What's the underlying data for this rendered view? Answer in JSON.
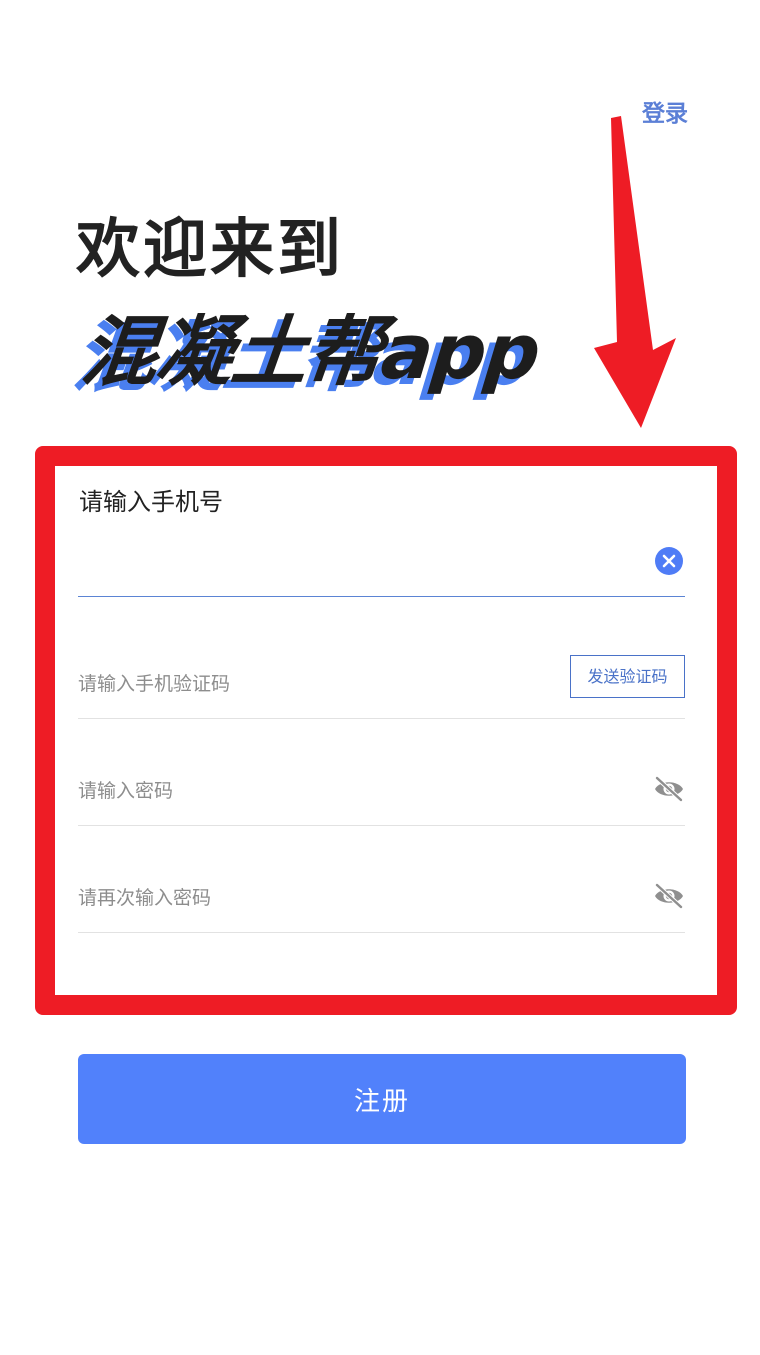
{
  "header": {
    "login_link": "登录"
  },
  "hero": {
    "welcome": "欢迎来到",
    "brand": "混凝土帮app"
  },
  "form": {
    "phone": {
      "label": "请输入手机号",
      "value": ""
    },
    "sms_code": {
      "placeholder": "请输入手机验证码",
      "send_button": "发送验证码"
    },
    "password": {
      "placeholder": "请输入密码"
    },
    "confirm_password": {
      "placeholder": "请再次输入密码"
    }
  },
  "actions": {
    "register_label": "注册"
  },
  "colors": {
    "accent": "#5181fb",
    "annotation_red": "#ee1c25",
    "link": "#5b7fd6"
  },
  "icons": {
    "clear": "close-circle-icon",
    "password_visibility": "eye-off-icon",
    "annotation": "arrow-down-icon"
  }
}
